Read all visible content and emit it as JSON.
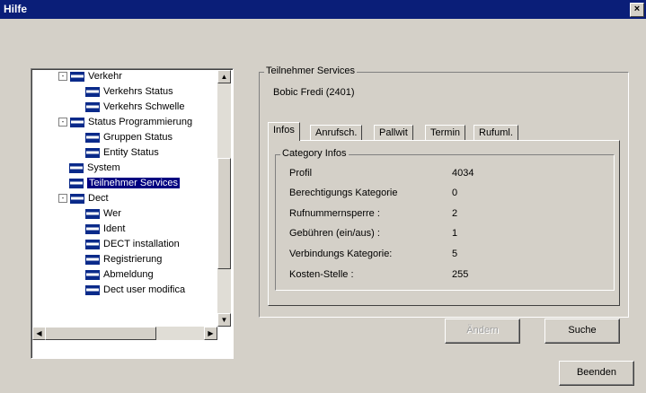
{
  "window": {
    "title": "Hilfe",
    "close_glyph": "×"
  },
  "tree": {
    "items": [
      {
        "label": "Verkehr",
        "level": 0,
        "expander": "-"
      },
      {
        "label": "Verkehrs Status",
        "level": 1
      },
      {
        "label": "Verkehrs Schwelle",
        "level": 1
      },
      {
        "label": "Status Programmierung",
        "level": 0,
        "expander": "-"
      },
      {
        "label": "Gruppen Status",
        "level": 1
      },
      {
        "label": "Entity Status",
        "level": 1
      },
      {
        "label": "System",
        "level": 0
      },
      {
        "label": "Teilnehmer Services",
        "level": 0,
        "selected": true
      },
      {
        "label": "Dect",
        "level": 0,
        "expander": "-"
      },
      {
        "label": "Wer",
        "level": 1
      },
      {
        "label": "Ident",
        "level": 1
      },
      {
        "label": "DECT installation",
        "level": 1
      },
      {
        "label": "Registrierung",
        "level": 1
      },
      {
        "label": "Abmeldung",
        "level": 1
      },
      {
        "label": "Dect user modifica",
        "level": 1
      }
    ]
  },
  "panel": {
    "group_title": "Teilnehmer Services",
    "subscriber": "Bobic Fredi (2401)",
    "tabs": [
      {
        "label": "Infos",
        "active": true
      },
      {
        "label": "Anrufsch."
      },
      {
        "label": "Pallwit"
      },
      {
        "label": "Termin"
      },
      {
        "label": "Rufuml."
      }
    ],
    "category_title": "Category Infos",
    "fields": [
      {
        "label": "Profil",
        "value": "4034"
      },
      {
        "label": "Berechtigungs Kategorie",
        "value": "0"
      },
      {
        "label": "Rufnummernsperre :",
        "value": "2"
      },
      {
        "label": "Gebühren (ein/aus) :",
        "value": "1"
      },
      {
        "label": "Verbindungs Kategorie:",
        "value": "5"
      },
      {
        "label": "Kosten-Stelle :",
        "value": "255"
      }
    ]
  },
  "buttons": {
    "disabled_label": "Ändern",
    "search_label": "Suche",
    "exit_label": "Beenden"
  }
}
